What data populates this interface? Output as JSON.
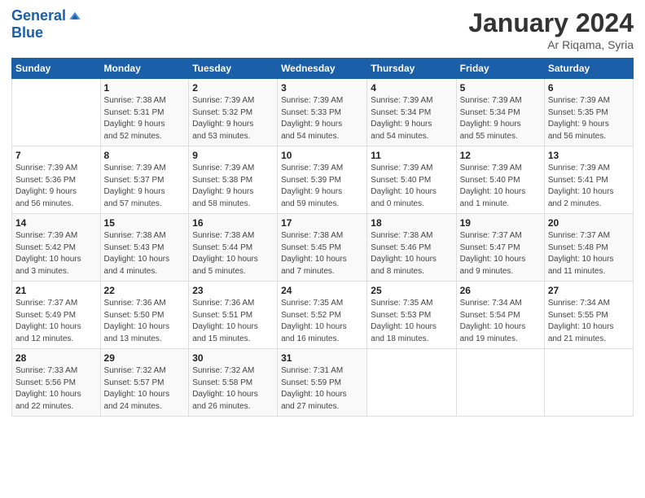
{
  "header": {
    "logo_line1": "General",
    "logo_line2": "Blue",
    "month": "January 2024",
    "location": "Ar Riqama, Syria"
  },
  "days_of_week": [
    "Sunday",
    "Monday",
    "Tuesday",
    "Wednesday",
    "Thursday",
    "Friday",
    "Saturday"
  ],
  "weeks": [
    [
      {
        "num": "",
        "info": ""
      },
      {
        "num": "1",
        "info": "Sunrise: 7:38 AM\nSunset: 5:31 PM\nDaylight: 9 hours\nand 52 minutes."
      },
      {
        "num": "2",
        "info": "Sunrise: 7:39 AM\nSunset: 5:32 PM\nDaylight: 9 hours\nand 53 minutes."
      },
      {
        "num": "3",
        "info": "Sunrise: 7:39 AM\nSunset: 5:33 PM\nDaylight: 9 hours\nand 54 minutes."
      },
      {
        "num": "4",
        "info": "Sunrise: 7:39 AM\nSunset: 5:34 PM\nDaylight: 9 hours\nand 54 minutes."
      },
      {
        "num": "5",
        "info": "Sunrise: 7:39 AM\nSunset: 5:34 PM\nDaylight: 9 hours\nand 55 minutes."
      },
      {
        "num": "6",
        "info": "Sunrise: 7:39 AM\nSunset: 5:35 PM\nDaylight: 9 hours\nand 56 minutes."
      }
    ],
    [
      {
        "num": "7",
        "info": "Sunrise: 7:39 AM\nSunset: 5:36 PM\nDaylight: 9 hours\nand 56 minutes."
      },
      {
        "num": "8",
        "info": "Sunrise: 7:39 AM\nSunset: 5:37 PM\nDaylight: 9 hours\nand 57 minutes."
      },
      {
        "num": "9",
        "info": "Sunrise: 7:39 AM\nSunset: 5:38 PM\nDaylight: 9 hours\nand 58 minutes."
      },
      {
        "num": "10",
        "info": "Sunrise: 7:39 AM\nSunset: 5:39 PM\nDaylight: 9 hours\nand 59 minutes."
      },
      {
        "num": "11",
        "info": "Sunrise: 7:39 AM\nSunset: 5:40 PM\nDaylight: 10 hours\nand 0 minutes."
      },
      {
        "num": "12",
        "info": "Sunrise: 7:39 AM\nSunset: 5:40 PM\nDaylight: 10 hours\nand 1 minute."
      },
      {
        "num": "13",
        "info": "Sunrise: 7:39 AM\nSunset: 5:41 PM\nDaylight: 10 hours\nand 2 minutes."
      }
    ],
    [
      {
        "num": "14",
        "info": "Sunrise: 7:39 AM\nSunset: 5:42 PM\nDaylight: 10 hours\nand 3 minutes."
      },
      {
        "num": "15",
        "info": "Sunrise: 7:38 AM\nSunset: 5:43 PM\nDaylight: 10 hours\nand 4 minutes."
      },
      {
        "num": "16",
        "info": "Sunrise: 7:38 AM\nSunset: 5:44 PM\nDaylight: 10 hours\nand 5 minutes."
      },
      {
        "num": "17",
        "info": "Sunrise: 7:38 AM\nSunset: 5:45 PM\nDaylight: 10 hours\nand 7 minutes."
      },
      {
        "num": "18",
        "info": "Sunrise: 7:38 AM\nSunset: 5:46 PM\nDaylight: 10 hours\nand 8 minutes."
      },
      {
        "num": "19",
        "info": "Sunrise: 7:37 AM\nSunset: 5:47 PM\nDaylight: 10 hours\nand 9 minutes."
      },
      {
        "num": "20",
        "info": "Sunrise: 7:37 AM\nSunset: 5:48 PM\nDaylight: 10 hours\nand 11 minutes."
      }
    ],
    [
      {
        "num": "21",
        "info": "Sunrise: 7:37 AM\nSunset: 5:49 PM\nDaylight: 10 hours\nand 12 minutes."
      },
      {
        "num": "22",
        "info": "Sunrise: 7:36 AM\nSunset: 5:50 PM\nDaylight: 10 hours\nand 13 minutes."
      },
      {
        "num": "23",
        "info": "Sunrise: 7:36 AM\nSunset: 5:51 PM\nDaylight: 10 hours\nand 15 minutes."
      },
      {
        "num": "24",
        "info": "Sunrise: 7:35 AM\nSunset: 5:52 PM\nDaylight: 10 hours\nand 16 minutes."
      },
      {
        "num": "25",
        "info": "Sunrise: 7:35 AM\nSunset: 5:53 PM\nDaylight: 10 hours\nand 18 minutes."
      },
      {
        "num": "26",
        "info": "Sunrise: 7:34 AM\nSunset: 5:54 PM\nDaylight: 10 hours\nand 19 minutes."
      },
      {
        "num": "27",
        "info": "Sunrise: 7:34 AM\nSunset: 5:55 PM\nDaylight: 10 hours\nand 21 minutes."
      }
    ],
    [
      {
        "num": "28",
        "info": "Sunrise: 7:33 AM\nSunset: 5:56 PM\nDaylight: 10 hours\nand 22 minutes."
      },
      {
        "num": "29",
        "info": "Sunrise: 7:32 AM\nSunset: 5:57 PM\nDaylight: 10 hours\nand 24 minutes."
      },
      {
        "num": "30",
        "info": "Sunrise: 7:32 AM\nSunset: 5:58 PM\nDaylight: 10 hours\nand 26 minutes."
      },
      {
        "num": "31",
        "info": "Sunrise: 7:31 AM\nSunset: 5:59 PM\nDaylight: 10 hours\nand 27 minutes."
      },
      {
        "num": "",
        "info": ""
      },
      {
        "num": "",
        "info": ""
      },
      {
        "num": "",
        "info": ""
      }
    ]
  ]
}
